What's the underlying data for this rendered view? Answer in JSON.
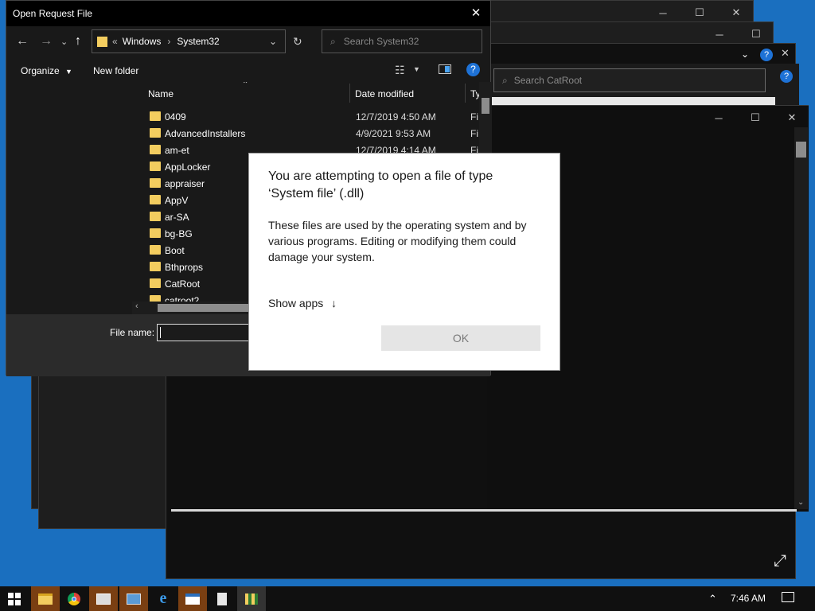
{
  "background_windows": {
    "catroot_search_placeholder": "Search CatRoot"
  },
  "file_dialog": {
    "title": "Open Request File",
    "breadcrumb": {
      "overflow": "«",
      "segment_1": "Windows",
      "segment_2": "System32"
    },
    "search_placeholder": "Search System32",
    "toolbar": {
      "organize_label": "Organize",
      "new_folder_label": "New folder"
    },
    "columns": {
      "name": "Name",
      "date_modified": "Date modified",
      "type": "Ty"
    },
    "rows": [
      {
        "name": "0409",
        "date": "12/7/2019 4:50 AM",
        "type": "Fi"
      },
      {
        "name": "AdvancedInstallers",
        "date": "4/9/2021 9:53 AM",
        "type": "Fi"
      },
      {
        "name": "am-et",
        "date": "12/7/2019 4:14 AM",
        "type": "Fi"
      },
      {
        "name": "AppLocker",
        "date": "",
        "type": ""
      },
      {
        "name": "appraiser",
        "date": "",
        "type": ""
      },
      {
        "name": "AppV",
        "date": "",
        "type": ""
      },
      {
        "name": "ar-SA",
        "date": "",
        "type": ""
      },
      {
        "name": "bg-BG",
        "date": "",
        "type": ""
      },
      {
        "name": "Boot",
        "date": "",
        "type": ""
      },
      {
        "name": "Bthprops",
        "date": "",
        "type": ""
      },
      {
        "name": "CatRoot",
        "date": "",
        "type": ""
      },
      {
        "name": "catroot2",
        "date": "",
        "type": ""
      }
    ],
    "file_name_label": "File name:",
    "file_name_value": ""
  },
  "modal": {
    "title": "You are attempting to open a file of type ‘System file’ (.dll)",
    "body": "These files are used by the operating system and by various programs. Editing or modifying them could damage your system.",
    "show_apps_label": "Show apps",
    "ok_label": "OK"
  },
  "taskbar": {
    "clock": "7:46 AM",
    "colors": {
      "accent_open": "#7a3f12"
    }
  },
  "icons": [
    "windows-logo-icon",
    "file-explorer-icon",
    "chrome-icon",
    "photos-icon",
    "control-panel-icon",
    "internet-explorer-icon",
    "app-icon",
    "calculator-icon",
    "app-icon",
    "chevron-up-icon",
    "notification-icon",
    "expand-icon"
  ]
}
